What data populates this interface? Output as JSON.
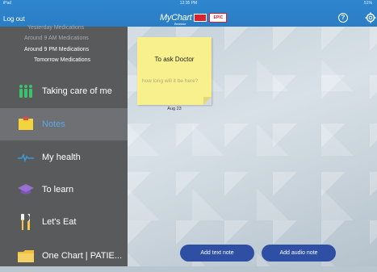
{
  "status_bar": {
    "device": "iPad",
    "time": "12:35 PM",
    "battery": "51%"
  },
  "header": {
    "logout_label": "Log out",
    "logo_text": "MyChart",
    "logo_sub": "Bedside",
    "logo_badge": "EPIC",
    "help_symbol": "?"
  },
  "sidebar": {
    "medications": [
      {
        "label": "Yesterday  Medications"
      },
      {
        "label": "Around 9 AM  Medications"
      },
      {
        "label": "Around 9 PM  Medications"
      },
      {
        "label": "Tomorrow  Medications"
      }
    ],
    "items": [
      {
        "label": "Taking care of me",
        "icon": "care-team-icon"
      },
      {
        "label": "Notes",
        "icon": "notes-icon"
      },
      {
        "label": "My health",
        "icon": "heartbeat-icon"
      },
      {
        "label": "To learn",
        "icon": "graduation-cap-icon"
      },
      {
        "label": "Let's Eat",
        "icon": "utensils-icon"
      },
      {
        "label": "One Chart | PATIE...",
        "icon": "folder-icon"
      }
    ]
  },
  "note": {
    "title": "To ask Doctor",
    "body": "how long will it be here?",
    "date": "Aug 23"
  },
  "actions": {
    "add_text_note": "Add text note",
    "add_audio_note": "Add audio note"
  },
  "colors": {
    "header": "#2a7dc4",
    "sidebar": "#585a5c",
    "sidebar_active": "#6e7073",
    "active_text": "#5aa9e6",
    "button": "#2e4fa3",
    "sticky_note": "#f8f08c"
  }
}
